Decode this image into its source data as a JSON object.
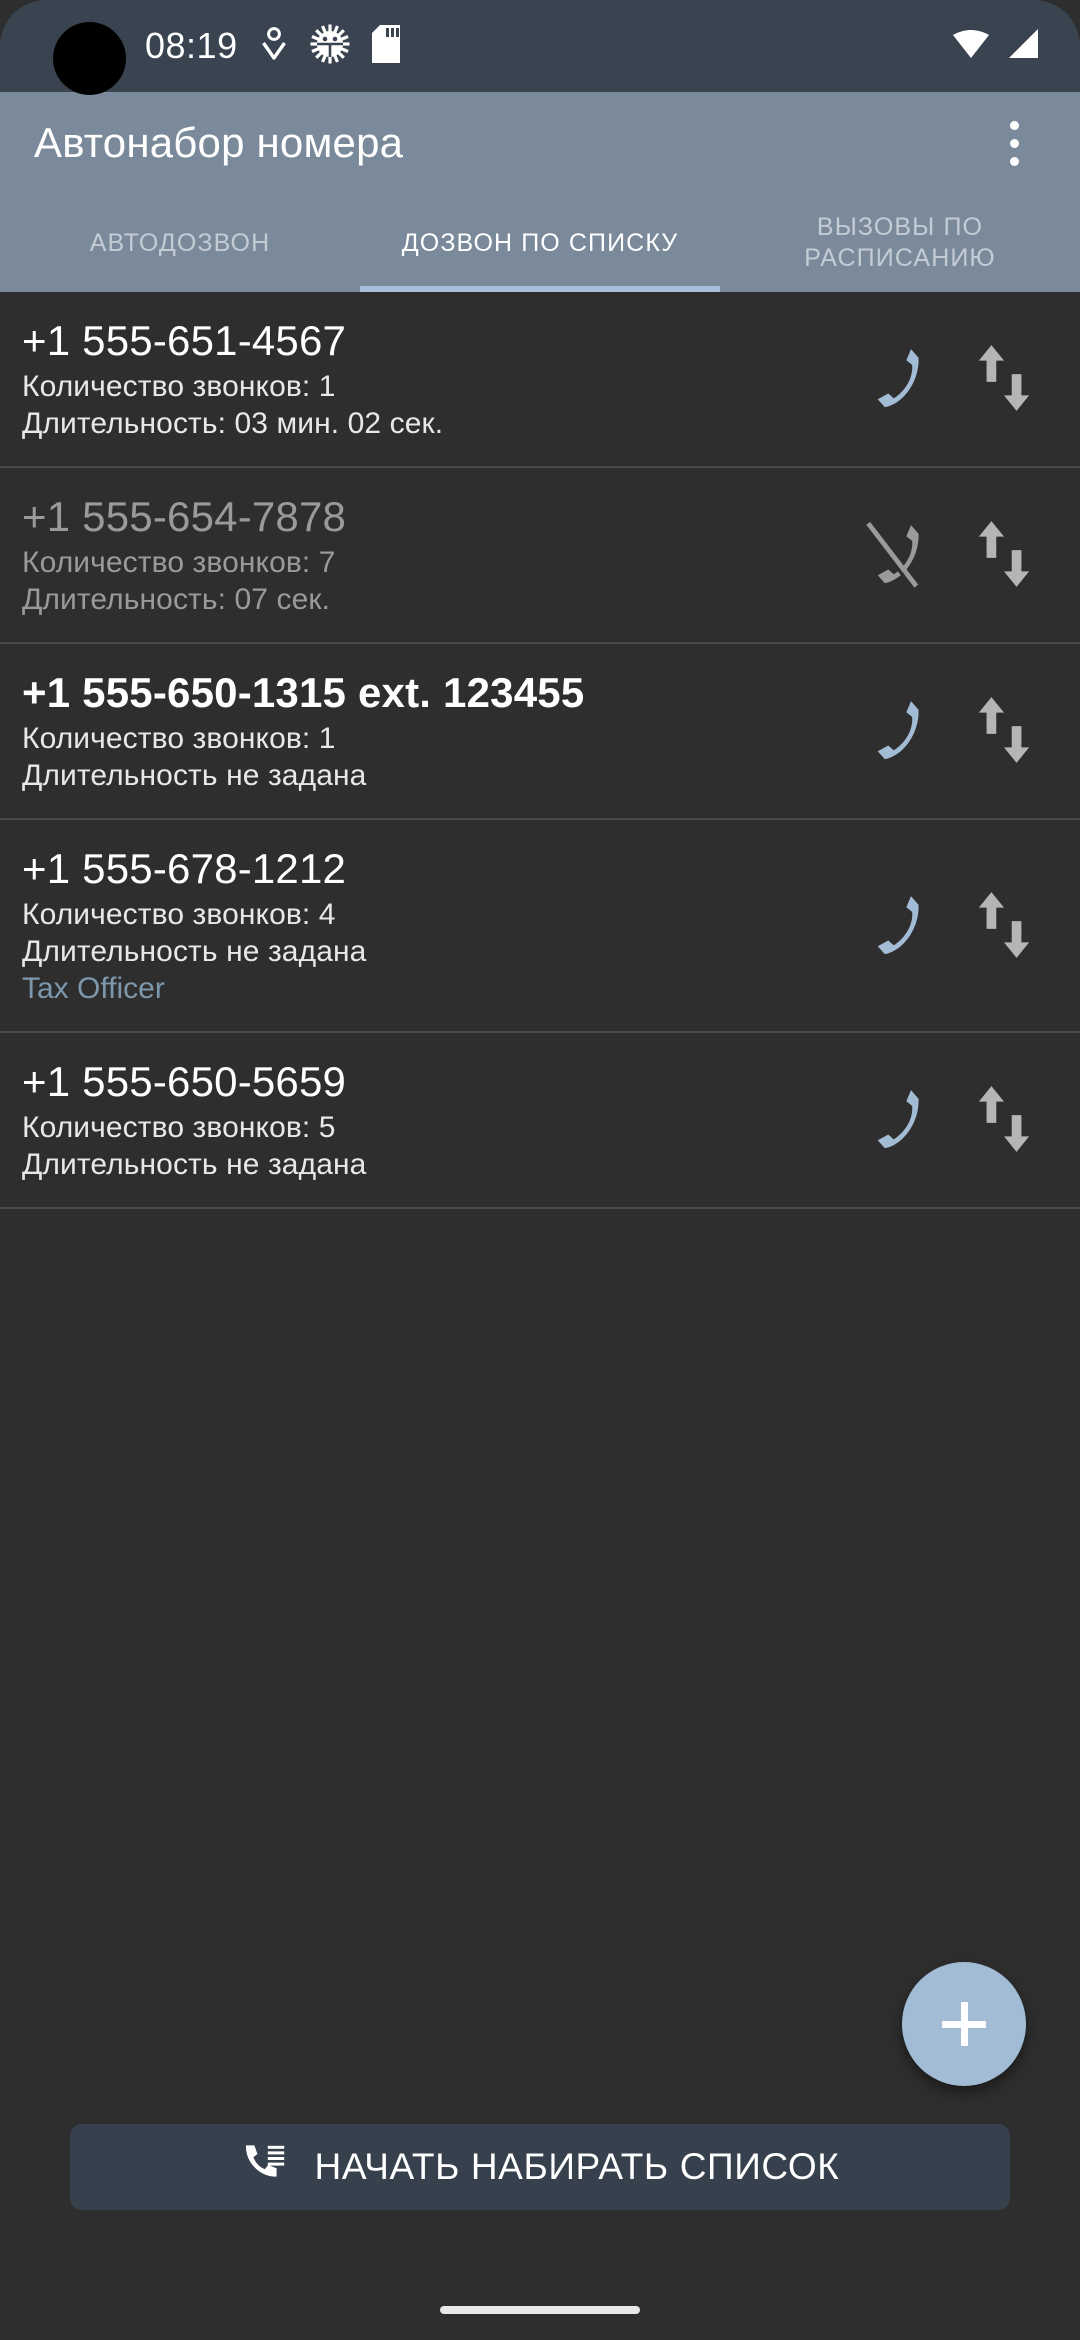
{
  "status_bar": {
    "time": "08:19",
    "icons_left": [
      "download-icon",
      "android-debug-icon",
      "sd-card-icon"
    ],
    "icons_right": [
      "wifi-icon",
      "signal-icon"
    ],
    "background": "#394450"
  },
  "app_bar": {
    "title": "Автонабор номера",
    "overflow_label": "overflow-menu",
    "background": "#7b8a9b"
  },
  "tabs": {
    "active_index": 1,
    "items": [
      {
        "label": "АВТОДОЗВОН"
      },
      {
        "label": "ДОЗВОН ПО СПИСКУ"
      },
      {
        "label": "ВЫЗОВЫ ПО РАСПИСАНИЮ"
      }
    ],
    "indicator_color": "#a9c0dd"
  },
  "list": {
    "rows": [
      {
        "number": "+1 555-651-4567",
        "calls": "Количество звонков: 1",
        "duration": "Длительность: 03 мин. 02 сек.",
        "note": "",
        "call_icon": "phone-icon",
        "reorder_icon": "reorder-arrows-icon",
        "enabled": true,
        "bold": false
      },
      {
        "number": "+1 555-654-7878",
        "calls": "Количество звонков: 7",
        "duration": "Длительность: 07 сек.",
        "note": "",
        "call_icon": "phone-off-icon",
        "reorder_icon": "reorder-arrows-icon",
        "enabled": false,
        "bold": false
      },
      {
        "number": "+1 555-650-1315 ext. 123455",
        "calls": "Количество звонков: 1",
        "duration": "Длительность не задана",
        "note": "",
        "call_icon": "phone-icon",
        "reorder_icon": "reorder-arrows-icon",
        "enabled": true,
        "bold": true
      },
      {
        "number": "+1 555-678-1212",
        "calls": "Количество звонков: 4",
        "duration": "Длительность не задана",
        "note": "Tax Officer",
        "call_icon": "phone-icon",
        "reorder_icon": "reorder-arrows-icon",
        "enabled": true,
        "bold": false
      },
      {
        "number": "+1 555-650-5659",
        "calls": "Количество звонков: 5",
        "duration": "Длительность не задана",
        "note": "",
        "call_icon": "phone-icon",
        "reorder_icon": "reorder-arrows-icon",
        "enabled": true,
        "bold": false
      }
    ],
    "phone_icon_color": "#a3bcd6",
    "phone_off_icon_color": "#9a9a9a",
    "reorder_icon_color": "#b5b5b5",
    "note_color": "#7d98ad"
  },
  "fab": {
    "icon": "plus-icon",
    "color": "#a3bcd6"
  },
  "bottom_button": {
    "label": "НАЧАТЬ НАБИРАТЬ СПИСОК",
    "icon": "dialer-list-icon",
    "background": "#37414d"
  }
}
